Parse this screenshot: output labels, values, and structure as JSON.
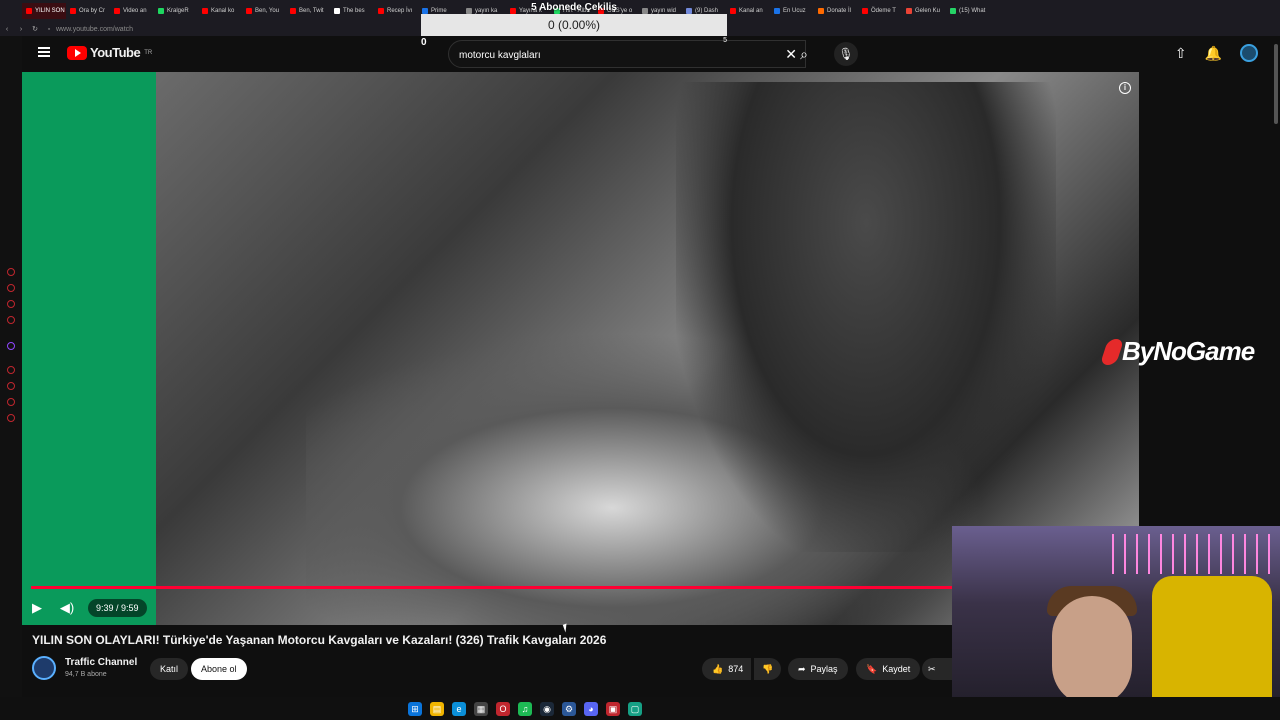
{
  "browser": {
    "url": "www.youtube.com/watch",
    "tabs": [
      {
        "label": "YILIN SON OLAYL",
        "color": "#ff0000",
        "active": true
      },
      {
        "label": "Ora by Cr",
        "color": "#ff0000"
      },
      {
        "label": "Video an",
        "color": "#ff0000"
      },
      {
        "label": "KralgeR",
        "color": "#1ed760"
      },
      {
        "label": "Kanal ko",
        "color": "#ff0000"
      },
      {
        "label": "Ben, You",
        "color": "#ff0000"
      },
      {
        "label": "Ben, Twit",
        "color": "#ff0000"
      },
      {
        "label": "The bes",
        "color": "#ffffff"
      },
      {
        "label": "Recep İvı",
        "color": "#ff0000"
      },
      {
        "label": "Prime",
        "color": "#1a73e8"
      },
      {
        "label": "yayın ka",
        "color": "#888888"
      },
      {
        "label": "Yayına k",
        "color": "#ff0000"
      },
      {
        "label": "Hırt - Albu",
        "color": "#1ed760"
      },
      {
        "label": "OBS'ye o",
        "color": "#ff0000"
      },
      {
        "label": "yayın wid",
        "color": "#888888"
      },
      {
        "label": "(9) Dash",
        "color": "#7289da"
      },
      {
        "label": "Kanal an",
        "color": "#ff0000"
      },
      {
        "label": "En Ucuz",
        "color": "#1a73e8"
      },
      {
        "label": "Donate İl",
        "color": "#ff6a00"
      },
      {
        "label": "Ödeme T",
        "color": "#ff0000"
      },
      {
        "label": "Gelen Ku",
        "color": "#ea4335"
      },
      {
        "label": "(15) What",
        "color": "#25d366"
      }
    ]
  },
  "overlay": {
    "title": "5 Abonede Çekiliş",
    "progress_text": "0 (0.00%)",
    "progress_fraction": 0.0,
    "min_label": "0",
    "max_label": "5"
  },
  "header": {
    "logo_text": "YouTube",
    "country_code": "TR",
    "search_value": "motorcu kavglaları"
  },
  "player": {
    "sponsor": "ByNoGame",
    "time": "9:39 / 9:59",
    "progress_fraction": 0.97
  },
  "video": {
    "title": "YILIN SON OLAYLARI! Türkiye'de Yaşanan Motorcu Kavgaları ve Kazaları! (326) Trafik Kavgaları 2026",
    "channel_name": "Traffic Channel",
    "subscribers": "94,7 B abone",
    "join_label": "Katıl",
    "subscribe_label": "Abone ol",
    "likes": "874",
    "share_label": "Paylaş",
    "save_label": "Kaydet"
  },
  "colors": {
    "accent": "#ff0033",
    "player_bg": "#0a9a5b"
  }
}
